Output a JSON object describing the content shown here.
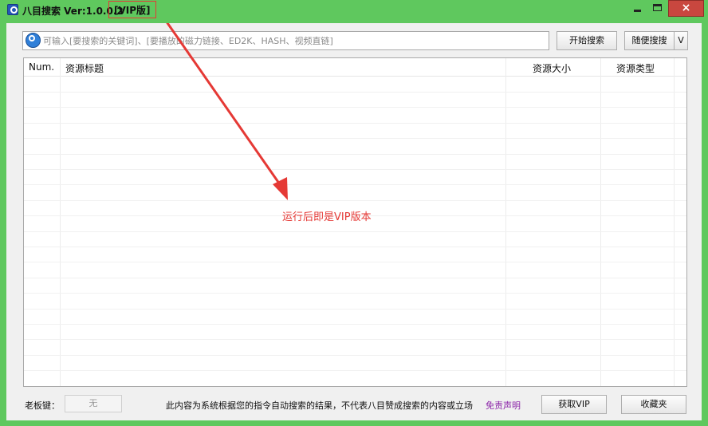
{
  "window": {
    "title": "八目搜索 Ver:1.0.0.2",
    "badge": "[VIP版]",
    "controls": {
      "close": "×"
    }
  },
  "search": {
    "placeholder": "可输入[要搜索的关键词]、[要播放的磁力链接、ED2K、HASH、视频直链]",
    "value": "",
    "search_button": "开始搜索",
    "random_button": "随便搜搜",
    "dropdown_symbol": "V"
  },
  "table": {
    "columns": [
      "Num.",
      "资源标题",
      "资源大小",
      "资源类型"
    ],
    "rows": []
  },
  "annotation": {
    "text": "运行后即是VIP版本",
    "color": "#e53935"
  },
  "footer": {
    "boss_key_label": "老板键：",
    "boss_key_value": "无",
    "disclaimer": "此内容为系统根据您的指令自动搜索的结果，不代表八目赞成搜索的内容或立场",
    "disclaimer_link": "免责声明",
    "vip_button": "获取VIP",
    "favorites_button": "收藏夹"
  },
  "colors": {
    "window_frame": "#5fc85e",
    "close_button": "#c9473f",
    "link": "#8b23a8"
  }
}
